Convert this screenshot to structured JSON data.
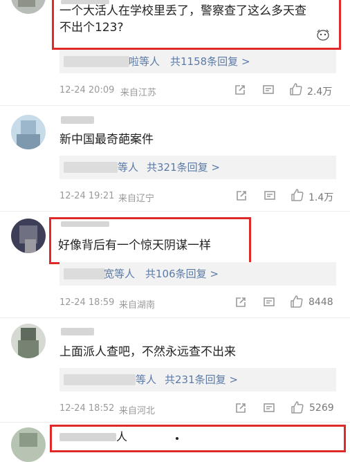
{
  "comments": [
    {
      "text_line1": "一个大活人在学校里丢了，警察查了这么多天查",
      "text_line2": "不出个123?",
      "reply_suffix": "啦等人",
      "reply_count": "共1158条回复 >",
      "timestamp": "12-24 20:09",
      "location": "来自江苏",
      "likes": "2.4万"
    },
    {
      "text": "新中国最奇葩案件",
      "reply_suffix": "等人",
      "reply_count": "共321条回复 >",
      "timestamp": "12-24 19:21",
      "location": "来自辽宁",
      "likes": "1.4万"
    },
    {
      "text": "好像背后有一个惊天阴谋一样",
      "reply_suffix": "宽等人",
      "reply_count": "共106条回复 >",
      "timestamp": "12-24 18:59",
      "location": "来自湖南",
      "likes": "8448"
    },
    {
      "text": "上面派人查吧，不然永远查不出来",
      "reply_suffix": "等人",
      "reply_count": "共231条回复 >",
      "timestamp": "12-24 18:52",
      "location": "来自河北",
      "likes": "5269"
    },
    {
      "text": "人"
    }
  ],
  "icons": {
    "share": "share-icon",
    "comment": "comment-icon",
    "like": "thumbs-up-icon"
  },
  "colors": {
    "highlight_box": "#e02a2a",
    "reply_link": "#5a7aa8",
    "meta_text": "#999999"
  }
}
